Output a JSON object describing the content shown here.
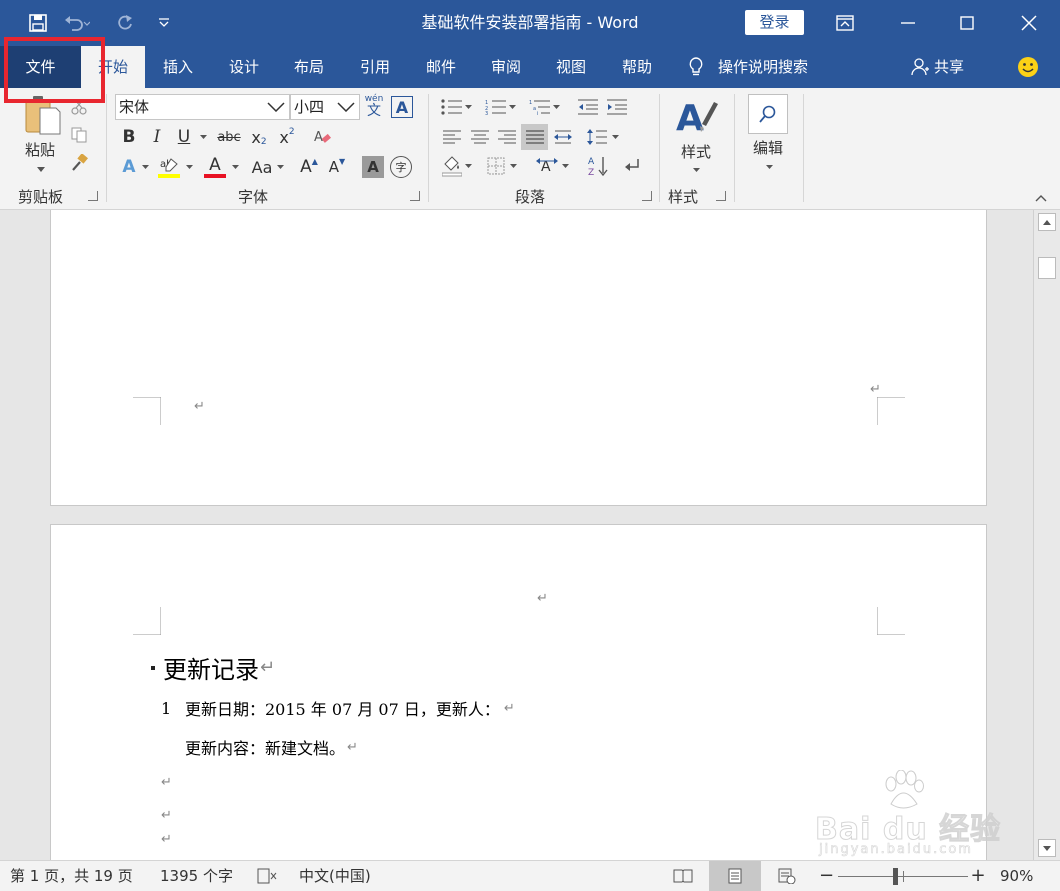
{
  "title_bar": {
    "title": "基础软件安装部署指南 - Word",
    "login_label": "登录"
  },
  "tabs": [
    {
      "label": "文件"
    },
    {
      "label": "开始"
    },
    {
      "label": "插入"
    },
    {
      "label": "设计"
    },
    {
      "label": "布局"
    },
    {
      "label": "引用"
    },
    {
      "label": "邮件"
    },
    {
      "label": "审阅"
    },
    {
      "label": "视图"
    },
    {
      "label": "帮助"
    }
  ],
  "tell_me": "操作说明搜索",
  "share_label": "共享",
  "ribbon": {
    "clipboard": {
      "paste_label": "粘贴",
      "group_label": "剪贴板"
    },
    "font": {
      "font_name": "宋体",
      "font_size": "小四",
      "phonetic_top": "wén",
      "phonetic_bottom": "文",
      "border_char": "A",
      "bold": "B",
      "italic": "I",
      "underline": "U",
      "strike": "abc",
      "sub": "x",
      "sup": "x",
      "text_effect": "A",
      "font_color": "A",
      "change_case": "Aa",
      "grow": "A",
      "shrink": "A",
      "shade": "A",
      "enclose": "字",
      "group_label": "字体"
    },
    "paragraph": {
      "group_label": "段落"
    },
    "styles": {
      "label": "样式",
      "group_label": "样式"
    },
    "editing": {
      "label": "编辑"
    }
  },
  "document": {
    "heading": "更新记录",
    "item_number": "1",
    "line1": "更新日期：2015 年 07 月 07 日，更新人：",
    "line2": "更新内容：新建文档。",
    "para_mark": "↵"
  },
  "status_bar": {
    "page": "第 1 页，共 19 页",
    "words": "1395 个字",
    "language": "中文(中国)",
    "zoom_minus": "−",
    "zoom_plus": "+",
    "zoom": "90%",
    "zoom_level": 0.9
  },
  "watermark": {
    "brand": "Bai du 经验",
    "url": "jingyan.baidu.com"
  }
}
